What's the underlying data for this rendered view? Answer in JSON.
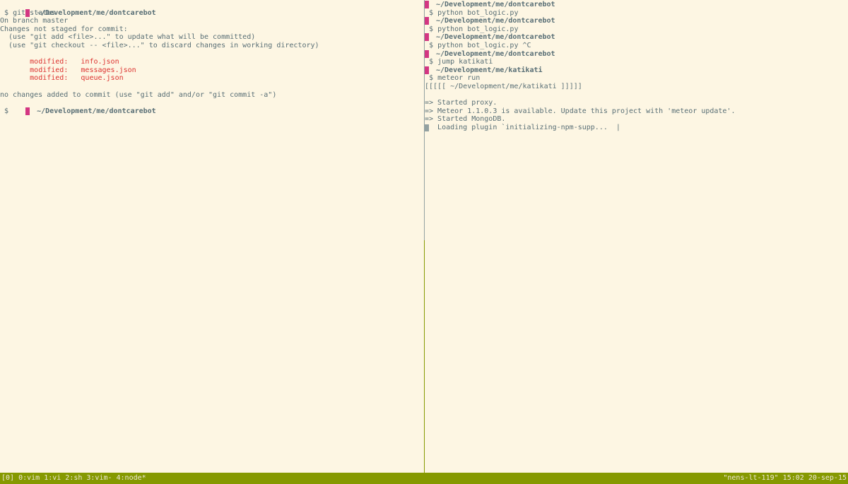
{
  "left_pane": {
    "prompt_path": "~/Development/me/dontcarebot",
    "command1": "$ git status",
    "branch_line": "On branch master",
    "changes_header": "Changes not staged for commit:",
    "hint1": "  (use \"git add <file>...\" to update what will be committed)",
    "hint2": "  (use \"git checkout -- <file>...\" to discard changes in working directory)",
    "modified_files": [
      {
        "label": "modified:",
        "file": "info.json"
      },
      {
        "label": "modified:",
        "file": "messages.json"
      },
      {
        "label": "modified:",
        "file": "queue.json"
      }
    ],
    "no_changes_line": "no changes added to commit (use \"git add\" and/or \"git commit -a\")",
    "prompt_path_2": "~/Development/me/dontcarebot",
    "prompt_symbol": "$"
  },
  "right_pane": {
    "entries": [
      {
        "path": "~/Development/me/dontcarebot",
        "cmd": "$ python bot_logic.py"
      },
      {
        "path": "~/Development/me/dontcarebot",
        "cmd": "$ python bot_logic.py"
      },
      {
        "path": "~/Development/me/dontcarebot",
        "cmd": "$ python bot_logic.py ^C"
      },
      {
        "path": "~/Development/me/dontcarebot",
        "cmd": "$ jump katikati"
      },
      {
        "path": "~/Development/me/katikati",
        "cmd": "$ meteor run"
      }
    ],
    "meteor_banner": "[[[[[ ~/Development/me/katikati ]]]]]",
    "output": [
      "=> Started proxy.",
      "=> Meteor 1.1.0.3 is available. Update this project with 'meteor update'.",
      "=> Started MongoDB."
    ],
    "loading_line": "Loading plugin `initializing-npm-supp...",
    "spinner": "|"
  },
  "statusbar": {
    "session": "[0]",
    "windows": [
      "0:vim",
      "1:vi",
      "2:sh",
      "3:vim-",
      "4:node*"
    ],
    "host": "\"nens-lt-119\"",
    "time": "15:02",
    "date": "20-sep-15"
  },
  "colors": {
    "background": "#fdf6e3",
    "text": "#586e75",
    "prompt_marker": "#d33682",
    "modified": "#dc322f",
    "statusbar": "#859900"
  }
}
